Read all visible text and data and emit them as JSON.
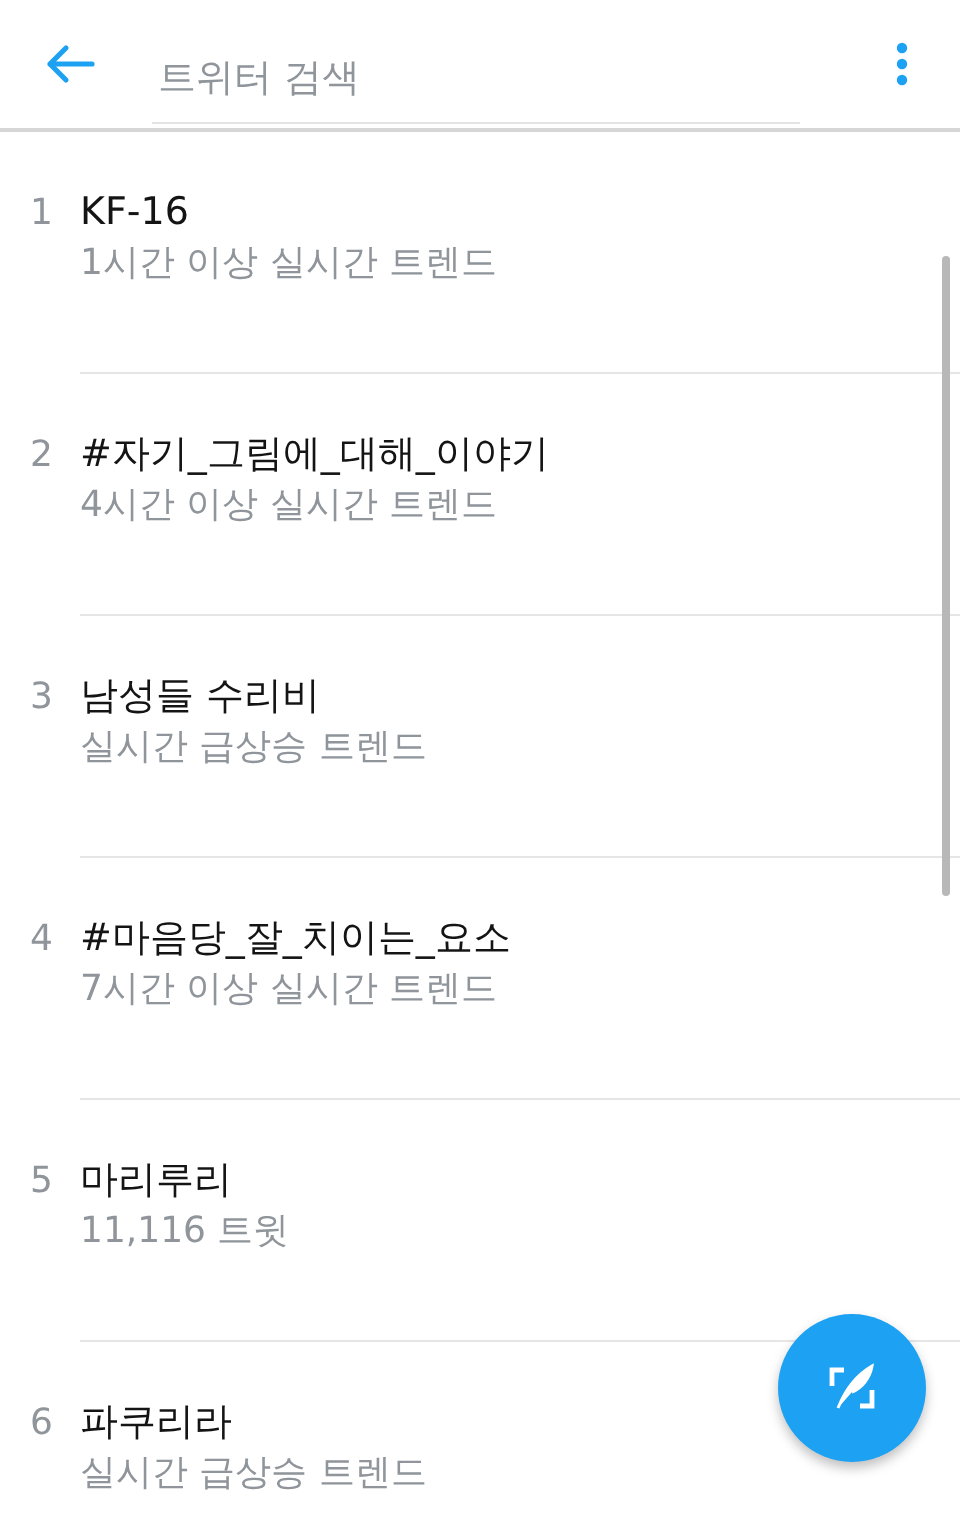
{
  "search": {
    "placeholder": "트위터 검색"
  },
  "trends": [
    {
      "rank": "1",
      "title": "KF-16",
      "subtitle": "1시간 이상 실시간 트렌드"
    },
    {
      "rank": "2",
      "title": "#자기_그림에_대해_이야기",
      "subtitle": "4시간 이상 실시간 트렌드"
    },
    {
      "rank": "3",
      "title": "남성들 수리비",
      "subtitle": "실시간 급상승 트렌드"
    },
    {
      "rank": "4",
      "title": "#마음당_잘_치이는_요소",
      "subtitle": "7시간 이상 실시간 트렌드"
    },
    {
      "rank": "5",
      "title": "마리루리",
      "subtitle": "11,116 트윗"
    },
    {
      "rank": "6",
      "title": "파쿠리라",
      "subtitle": "실시간 급상승 트렌드"
    }
  ]
}
